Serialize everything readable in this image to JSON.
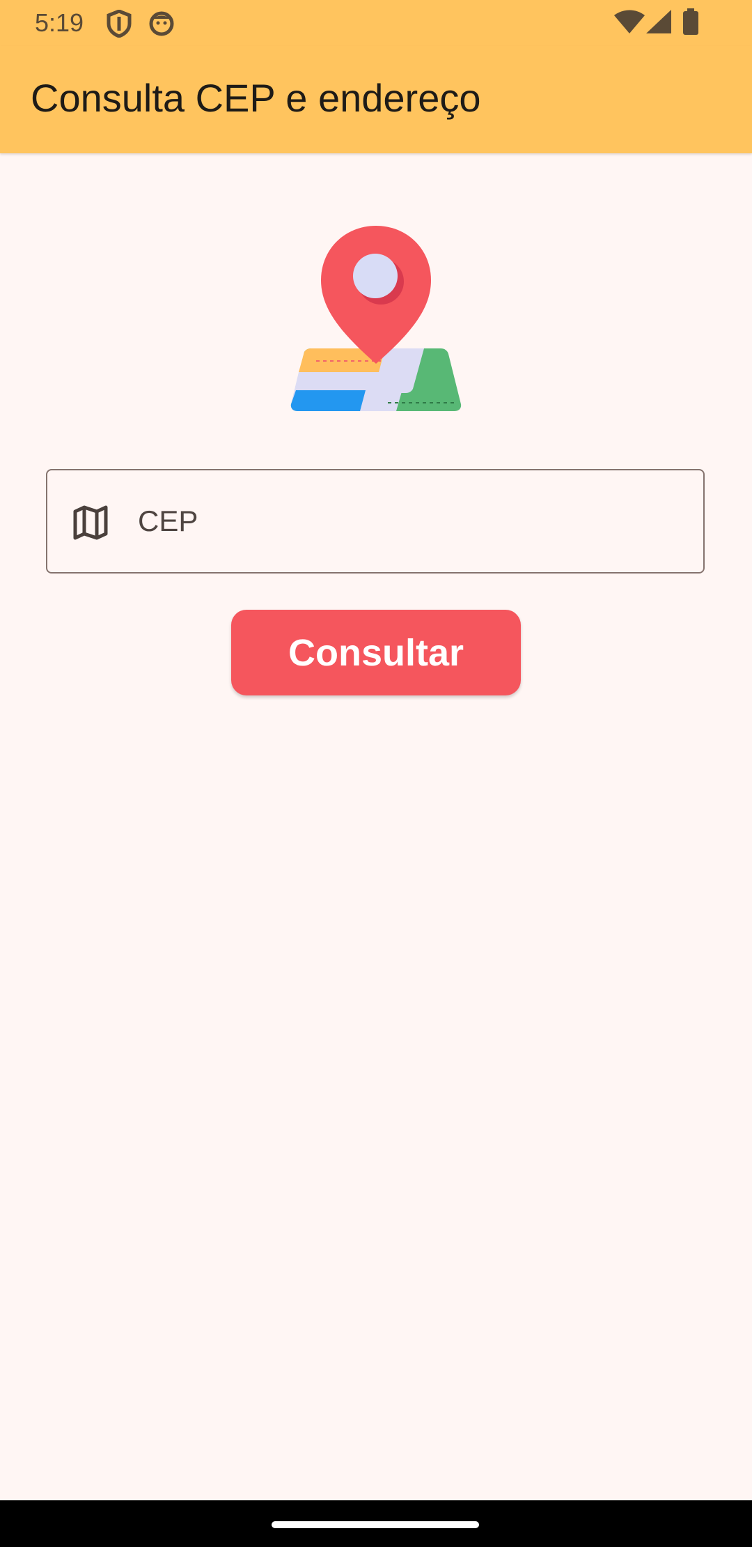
{
  "status_bar": {
    "time": "5:19",
    "icons": [
      "shield-icon",
      "face-icon",
      "wifi-icon",
      "signal-icon",
      "battery-icon"
    ]
  },
  "app_bar": {
    "title": "Consulta CEP e endereço",
    "color": "#ffc45e"
  },
  "hero": {
    "icon": "map-pin-icon"
  },
  "search": {
    "icon": "map-icon",
    "placeholder": "CEP",
    "value": ""
  },
  "actions": {
    "consultar_label": "Consultar",
    "color": "#f5565d"
  },
  "colors": {
    "background": "#fff6f4",
    "status_text": "#5a4a36",
    "field_border": "#85736e"
  }
}
